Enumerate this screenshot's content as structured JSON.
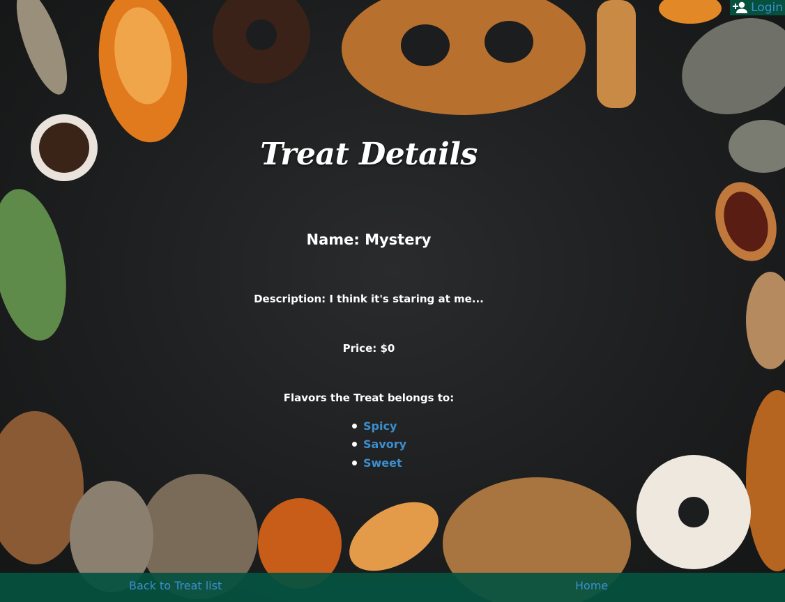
{
  "header": {
    "login_label": "Login",
    "login_icon": "person-add-icon"
  },
  "page": {
    "title": "Treat Details"
  },
  "treat": {
    "name": "Name: Mystery",
    "description": "Description: I think it's staring at me...",
    "price": "Price: $0",
    "flavors_heading": "Flavors the Treat belongs to:",
    "flavors": [
      "Spicy",
      "Savory",
      "Sweet"
    ]
  },
  "footer": {
    "back_label": "Back to Treat list",
    "home_label": "Home"
  },
  "colors": {
    "link": "#3c8fd0",
    "nav_bar": "#05513e",
    "background": "#1c1d1e"
  }
}
